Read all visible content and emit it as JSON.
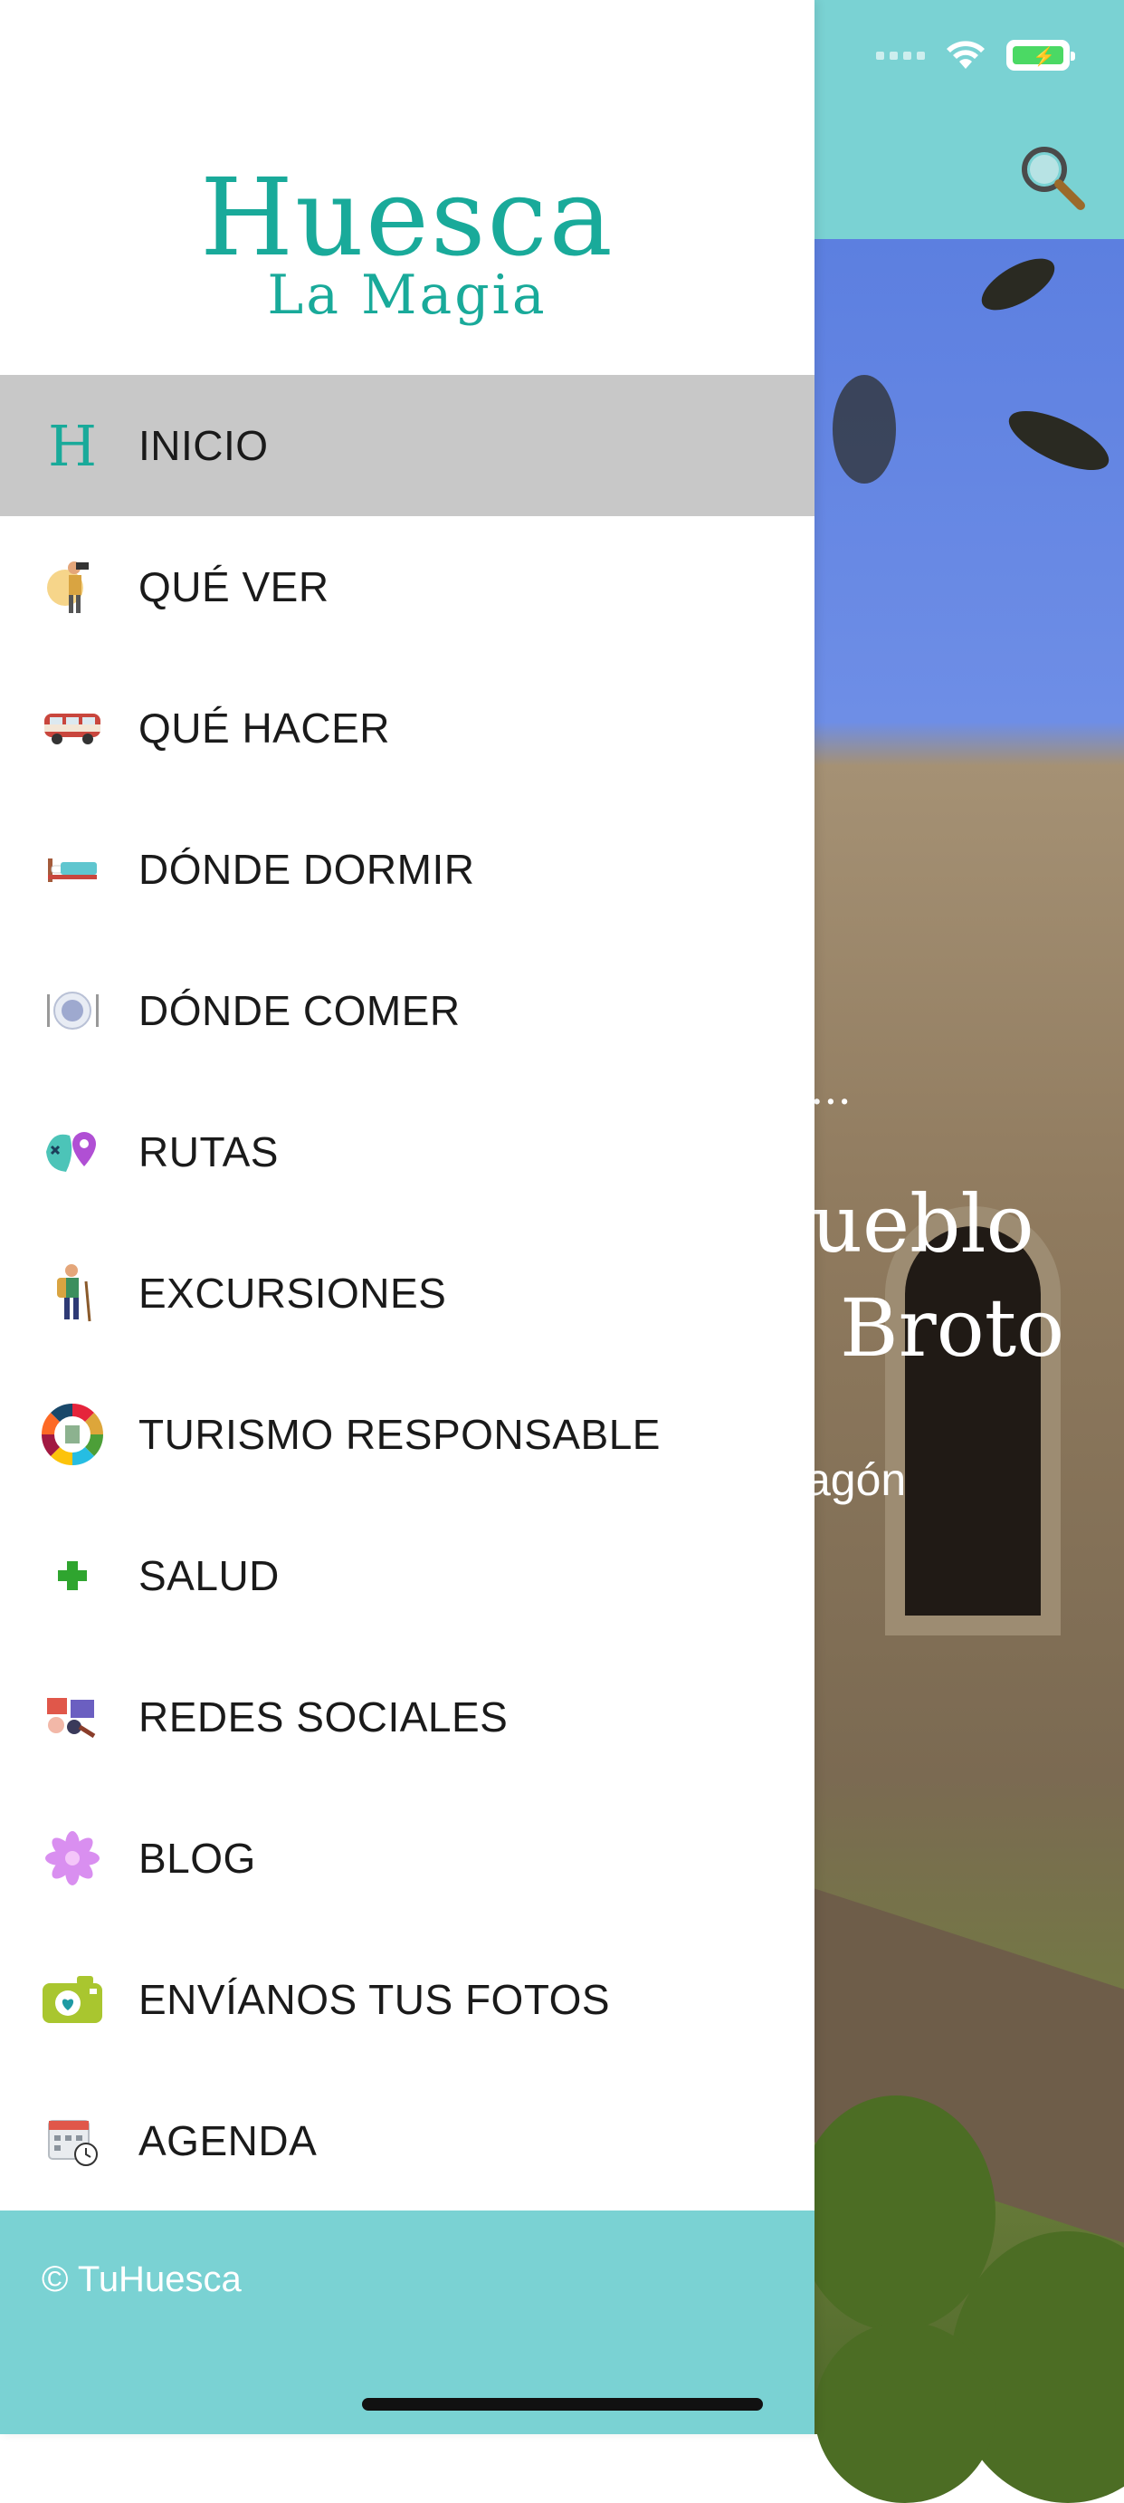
{
  "status_bar": {
    "icons": [
      "signal-icon",
      "wifi-icon",
      "battery-charging-icon"
    ],
    "battery_color": "#4bd964"
  },
  "header": {
    "search_icon": "search-icon",
    "bar_color": "#7ad2d3"
  },
  "background_card": {
    "ellipsis": "...",
    "title_line1": "pueblo",
    "title_line2": "Broto",
    "subtitle": "agón"
  },
  "drawer": {
    "logo_main": "Huesca",
    "logo_sub": "La Magia",
    "accent_color": "#19aa9a",
    "items": [
      {
        "label": "INICIO",
        "icon": "h-logo-icon",
        "active": true
      },
      {
        "label": "QUÉ VER",
        "icon": "photographer-icon"
      },
      {
        "label": "QUÉ HACER",
        "icon": "camper-van-icon"
      },
      {
        "label": "DÓNDE DORMIR",
        "icon": "bed-icon"
      },
      {
        "label": "DÓNDE COMER",
        "icon": "plate-icon"
      },
      {
        "label": "RUTAS",
        "icon": "map-pin-icon"
      },
      {
        "label": "EXCURSIONES",
        "icon": "hiker-icon"
      },
      {
        "label": "TURISMO RESPONSABLE",
        "icon": "sdg-wheel-icon"
      },
      {
        "label": "SALUD",
        "icon": "health-cross-icon"
      },
      {
        "label": "REDES SOCIALES",
        "icon": "social-network-icon"
      },
      {
        "label": "BLOG",
        "icon": "flower-icon"
      },
      {
        "label": "ENVÍANOS TUS FOTOS",
        "icon": "camera-icon"
      },
      {
        "label": "AGENDA",
        "icon": "calendar-icon"
      }
    ],
    "footer_text": "© TuHuesca"
  }
}
